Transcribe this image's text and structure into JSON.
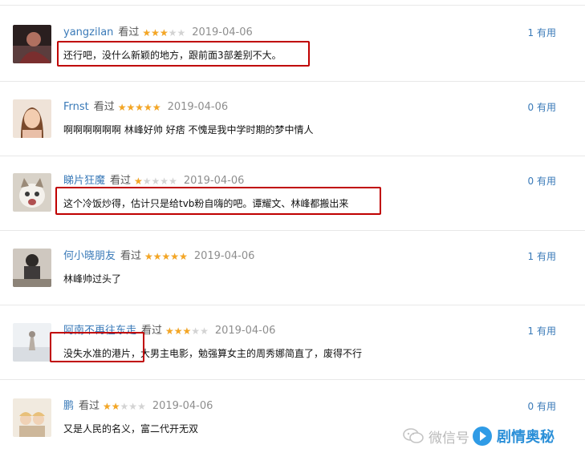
{
  "comments": [
    {
      "user": "yangzilan",
      "status": "看过",
      "rating": 3,
      "date": "2019-04-06",
      "useful_count": "1",
      "useful_label": "有用",
      "text": "还行吧，没什么新颖的地方，跟前面3部差别不大。",
      "highlighted": true
    },
    {
      "user": "Frnst",
      "status": "看过",
      "rating": 5,
      "date": "2019-04-06",
      "useful_count": "0",
      "useful_label": "有用",
      "text": "啊啊啊啊啊啊 林峰好帅 好痞 不愧是我中学时期的梦中情人",
      "highlighted": false
    },
    {
      "user": "睇片狂魔",
      "status": "看过",
      "rating": 1,
      "date": "2019-04-06",
      "useful_count": "0",
      "useful_label": "有用",
      "text": "这个冷饭炒得，估计只是给tvb粉自嗨的吧。谭耀文、林峰都搬出来",
      "highlighted": true
    },
    {
      "user": "何小晓朋友",
      "status": "看过",
      "rating": 5,
      "date": "2019-04-06",
      "useful_count": "1",
      "useful_label": "有用",
      "text": "林峰帅过头了",
      "highlighted": false
    },
    {
      "user": "阿南不再往东走",
      "status": "看过",
      "rating": 3,
      "date": "2019-04-06",
      "useful_count": "1",
      "useful_label": "有用",
      "text": "没失水准的港片，大男主电影，勉强算女主的周秀娜简直了，废得不行",
      "highlighted": true
    },
    {
      "user": "鹏",
      "status": "看过",
      "rating": 2,
      "date": "2019-04-06",
      "useful_count": "0",
      "useful_label": "有用",
      "text": "又是人民的名义，富二代开无双",
      "highlighted": false
    }
  ],
  "watermark": {
    "prefix": "微信号",
    "brand": "剧情奥秘"
  },
  "colors": {
    "username": "#3a7ab8",
    "star_filled": "#f5a623",
    "star_empty": "#d3d3d3",
    "highlight_box": "#c00000"
  }
}
